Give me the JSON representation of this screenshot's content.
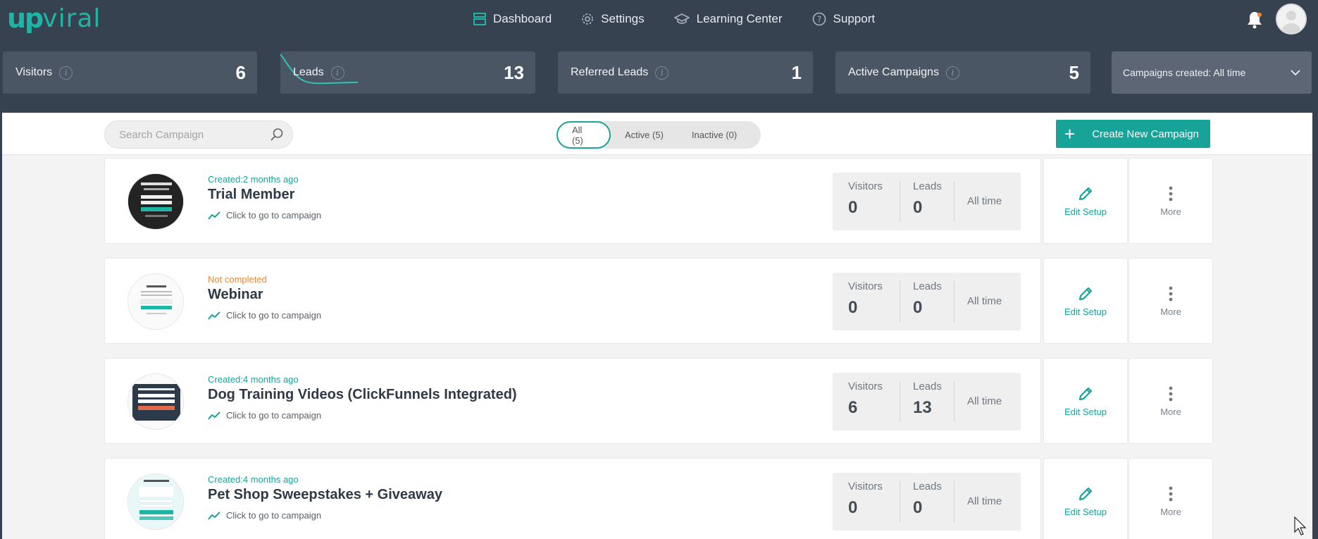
{
  "brand": {
    "logo_up": "up",
    "logo_viral": "viral",
    "accent": "#17a398"
  },
  "nav": [
    {
      "label": "Dashboard",
      "icon": "dashboard-icon"
    },
    {
      "label": "Settings",
      "icon": "gear-icon"
    },
    {
      "label": "Learning Center",
      "icon": "graduation-cap-icon"
    },
    {
      "label": "Support",
      "icon": "question-circle-icon"
    }
  ],
  "stats": [
    {
      "label": "Visitors",
      "value": "6"
    },
    {
      "label": "Leads",
      "value": "13"
    },
    {
      "label": "Referred Leads",
      "value": "1"
    },
    {
      "label": "Active Campaigns",
      "value": "5"
    }
  ],
  "date_filter": {
    "label": "Campaigns created: All time"
  },
  "toolbar": {
    "search_placeholder": "Search Campaign",
    "filters": [
      "All (5)",
      "Active (5)",
      "Inactive (0)"
    ],
    "create_label": "Create New Campaign"
  },
  "campaigns": [
    {
      "status": "Created:2 months ago",
      "name": "Trial Member",
      "goto": "Click to go to campaign",
      "visitors_label": "Visitors",
      "visitors": "0",
      "leads_label": "Leads",
      "leads": "0",
      "period": "All time",
      "edit": "Edit Setup",
      "more": "More"
    },
    {
      "status": "Not completed",
      "name": "Webinar",
      "goto": "Click to go to campaign",
      "visitors_label": "Visitors",
      "visitors": "0",
      "leads_label": "Leads",
      "leads": "0",
      "period": "All time",
      "edit": "Edit Setup",
      "more": "More"
    },
    {
      "status": "Created:4 months ago",
      "name": "Dog Training Videos (ClickFunnels Integrated)",
      "goto": "Click to go to campaign",
      "visitors_label": "Visitors",
      "visitors": "6",
      "leads_label": "Leads",
      "leads": "13",
      "period": "All time",
      "edit": "Edit Setup",
      "more": "More"
    },
    {
      "status": "Created:4 months ago",
      "name": "Pet Shop Sweepstakes + Giveaway",
      "goto": "Click to go to campaign",
      "visitors_label": "Visitors",
      "visitors": "0",
      "leads_label": "Leads",
      "leads": "0",
      "period": "All time",
      "edit": "Edit Setup",
      "more": "More"
    }
  ]
}
